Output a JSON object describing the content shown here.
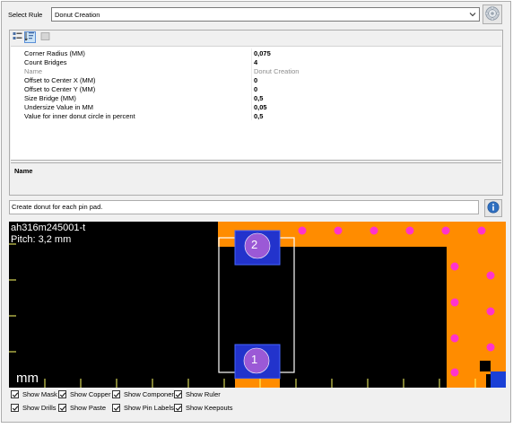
{
  "select": {
    "label": "Select Rule",
    "value": "Donut Creation"
  },
  "icons": {
    "settings": "gear-icon",
    "sort_categorized": "categorized-icon",
    "sort_alpha": "alphabetical-sort-icon",
    "property_pages": "property-pages-icon",
    "info": "info-icon",
    "dropdown": "chevron-down-icon"
  },
  "properties": [
    {
      "name": "Corner Radius (MM)",
      "value": "0,075",
      "disabled": false
    },
    {
      "name": "Count Bridges",
      "value": "4",
      "disabled": false
    },
    {
      "name": "Name",
      "value": "Donut Creation",
      "disabled": true
    },
    {
      "name": "Offset to Center X (MM)",
      "value": "0",
      "disabled": false
    },
    {
      "name": "Offset to Center Y (MM)",
      "value": "0",
      "disabled": false
    },
    {
      "name": "Size Bridge (MM)",
      "value": "0,5",
      "disabled": false
    },
    {
      "name": "Undersize Value in MM",
      "value": "0,05",
      "disabled": false
    },
    {
      "name": "Value for inner donut circle in percent",
      "value": "0,5",
      "disabled": false
    }
  ],
  "description": {
    "title": "Name"
  },
  "hint": "Create donut for each pin pad.",
  "preview": {
    "part_name": "ah316m245001-t",
    "pitch": "Pitch: 3,2 mm",
    "unit": "mm",
    "pin_labels": [
      "2",
      "1"
    ],
    "colors": {
      "background": "#000000",
      "copper": "#ff8c00",
      "mask_dots": "#ff33cc",
      "pad": "#2233cc",
      "pad_circle": "#9b59d6",
      "outline": "#ffffff",
      "ruler": "#ffff66"
    }
  },
  "checkboxes": [
    [
      {
        "label": "Show Mask",
        "checked": true
      },
      {
        "label": "Show Copper",
        "checked": true
      },
      {
        "label": "Show Component",
        "checked": true
      },
      {
        "label": "Show Ruler",
        "checked": true
      }
    ],
    [
      {
        "label": "Show Drills",
        "checked": true
      },
      {
        "label": "Show Paste",
        "checked": true
      },
      {
        "label": "Show Pin Labels",
        "checked": true
      },
      {
        "label": "Show Keepouts",
        "checked": true
      }
    ]
  ]
}
